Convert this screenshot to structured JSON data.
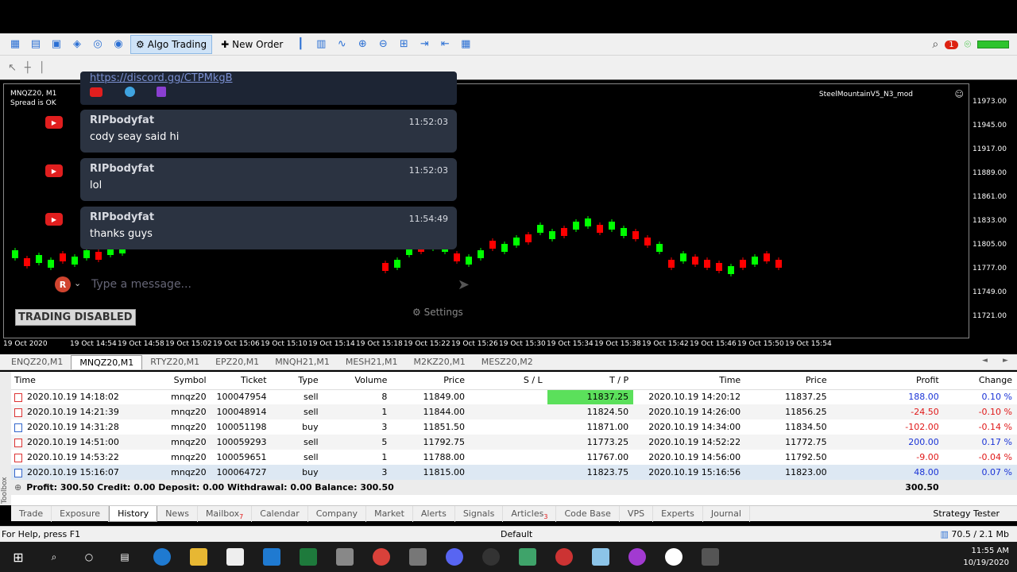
{
  "toolbar": {
    "algo_trading_label": "Algo Trading",
    "new_order_label": "New Order",
    "notification_count": "1"
  },
  "chart": {
    "symbol_line": "MNQZ20, M1",
    "spread_status": "Spread is OK",
    "ea_name": "SteelMountainV5_N3_mod",
    "trading_disabled_label": "TRADING DISABLED",
    "price_ticks": [
      "11973.00",
      "11945.00",
      "11917.00",
      "11889.00",
      "11861.00",
      "11833.00",
      "11805.00",
      "11777.00",
      "11749.00",
      "11721.00"
    ],
    "time_ticks": [
      "19 Oct 2020",
      "19 Oct 14:54",
      "19 Oct 14:58",
      "19 Oct 15:02",
      "19 Oct 15:06",
      "19 Oct 15:10",
      "19 Oct 15:14",
      "19 Oct 15:18",
      "19 Oct 15:22",
      "19 Oct 15:26",
      "19 Oct 15:30",
      "19 Oct 15:34",
      "19 Oct 15:38",
      "19 Oct 15:42",
      "19 Oct 15:46",
      "19 Oct 15:50",
      "19 Oct 15:54"
    ]
  },
  "chat": {
    "link_text": "https://discord.gg/CTPMkgB",
    "messages": [
      {
        "author": "RIPbodyfat",
        "time": "11:52:03",
        "text": "cody seay said hi"
      },
      {
        "author": "RIPbodyfat",
        "time": "11:52:03",
        "text": "lol"
      },
      {
        "author": "RIPbodyfat",
        "time": "11:54:49",
        "text": "thanks guys"
      }
    ],
    "input_placeholder": "Type a message...",
    "avatar_letter": "R",
    "settings_label": "Settings"
  },
  "symbol_tabs": [
    "ENQZ20,M1",
    "MNQZ20,M1",
    "RTYZ20,M1",
    "EPZ20,M1",
    "MNQH21,M1",
    "MESH21,M1",
    "M2KZ20,M1",
    "MESZ20,M2"
  ],
  "active_symbol_tab": "MNQZ20,M1",
  "history": {
    "columns": [
      "Time",
      "Symbol",
      "Ticket",
      "Type",
      "Volume",
      "Price",
      "S / L",
      "T / P",
      "Time",
      "Price",
      "Profit",
      "Change"
    ],
    "rows": [
      {
        "open_time": "2020.10.19 14:18:02",
        "symbol": "mnqz20",
        "ticket": "100047954",
        "type": "sell",
        "volume": "8",
        "price": "11849.00",
        "sl": "",
        "tp": "11837.25",
        "close_time": "2020.10.19 14:20:12",
        "close_price": "11837.25",
        "profit": "188.00",
        "change": "0.10 %"
      },
      {
        "open_time": "2020.10.19 14:21:39",
        "symbol": "mnqz20",
        "ticket": "100048914",
        "type": "sell",
        "volume": "1",
        "price": "11844.00",
        "sl": "",
        "tp": "11824.50",
        "close_time": "2020.10.19 14:26:00",
        "close_price": "11856.25",
        "profit": "-24.50",
        "change": "-0.10 %"
      },
      {
        "open_time": "2020.10.19 14:31:28",
        "symbol": "mnqz20",
        "ticket": "100051198",
        "type": "buy",
        "volume": "3",
        "price": "11851.50",
        "sl": "",
        "tp": "11871.00",
        "close_time": "2020.10.19 14:34:00",
        "close_price": "11834.50",
        "profit": "-102.00",
        "change": "-0.14 %"
      },
      {
        "open_time": "2020.10.19 14:51:00",
        "symbol": "mnqz20",
        "ticket": "100059293",
        "type": "sell",
        "volume": "5",
        "price": "11792.75",
        "sl": "",
        "tp": "11773.25",
        "close_time": "2020.10.19 14:52:22",
        "close_price": "11772.75",
        "profit": "200.00",
        "change": "0.17 %"
      },
      {
        "open_time": "2020.10.19 14:53:22",
        "symbol": "mnqz20",
        "ticket": "100059651",
        "type": "sell",
        "volume": "1",
        "price": "11788.00",
        "sl": "",
        "tp": "11767.00",
        "close_time": "2020.10.19 14:56:00",
        "close_price": "11792.50",
        "profit": "-9.00",
        "change": "-0.04 %"
      },
      {
        "open_time": "2020.10.19 15:16:07",
        "symbol": "mnqz20",
        "ticket": "100064727",
        "type": "buy",
        "volume": "3",
        "price": "11815.00",
        "sl": "",
        "tp": "11823.75",
        "close_time": "2020.10.19 15:16:56",
        "close_price": "11823.00",
        "profit": "48.00",
        "change": "0.07 %"
      }
    ],
    "summary": "Profit: 300.50  Credit: 0.00  Deposit: 0.00  Withdrawal: 0.00  Balance: 300.50",
    "summary_total": "300.50"
  },
  "bottom_tabs": [
    {
      "label": "Trade",
      "badge": ""
    },
    {
      "label": "Exposure",
      "badge": ""
    },
    {
      "label": "History",
      "badge": ""
    },
    {
      "label": "News",
      "badge": ""
    },
    {
      "label": "Mailbox",
      "badge": "7"
    },
    {
      "label": "Calendar",
      "badge": ""
    },
    {
      "label": "Company",
      "badge": ""
    },
    {
      "label": "Market",
      "badge": ""
    },
    {
      "label": "Alerts",
      "badge": ""
    },
    {
      "label": "Signals",
      "badge": ""
    },
    {
      "label": "Articles",
      "badge": "3"
    },
    {
      "label": "Code Base",
      "badge": ""
    },
    {
      "label": "VPS",
      "badge": ""
    },
    {
      "label": "Experts",
      "badge": ""
    },
    {
      "label": "Journal",
      "badge": ""
    }
  ],
  "active_bottom_tab": "History",
  "strategy_tester_label": "Strategy Tester",
  "toolbox_label": "Toolbox",
  "status": {
    "help_text": "For Help, press F1",
    "profile": "Default",
    "memory": "70.5 / 2.1 Mb"
  },
  "clock": {
    "time": "11:55 AM",
    "date": "10/19/2020"
  },
  "colors": {
    "tp_hit": "#5be05b",
    "profit_positive": "#1a33d6",
    "profit_negative": "#e01818",
    "candle_up": "#00ff00",
    "candle_down": "#ff0000"
  }
}
